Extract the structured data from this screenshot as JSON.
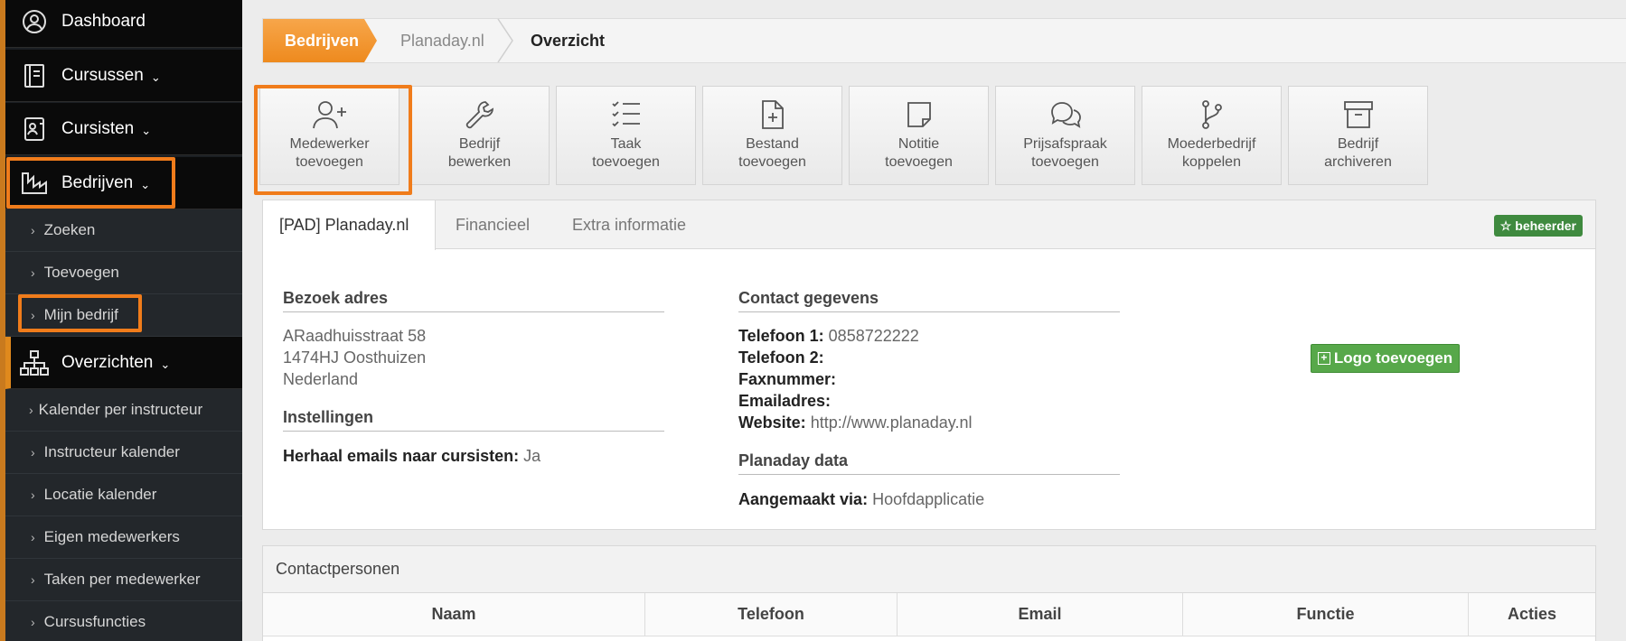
{
  "sidebar": {
    "main": [
      {
        "label": "Dashboard",
        "icon": "user-circle-icon"
      },
      {
        "label": "Cursussen",
        "icon": "book-icon"
      },
      {
        "label": "Cursisten",
        "icon": "id-card-icon"
      },
      {
        "label": "Bedrijven",
        "icon": "factory-icon"
      },
      {
        "label": "Overzichten",
        "icon": "sitemap-icon"
      }
    ],
    "bedrijven_sub": [
      "Zoeken",
      "Toevoegen",
      "Mijn bedrijf"
    ],
    "overzichten_sub": [
      "Kalender per instructeur",
      "Instructeur kalender",
      "Locatie kalender",
      "Eigen medewerkers",
      "Taken per medewerker",
      "Cursusfuncties"
    ]
  },
  "breadcrumb": [
    "Bedrijven",
    "Planaday.nl",
    "Overzicht"
  ],
  "toolbar": [
    {
      "line1": "Medewerker",
      "line2": "toevoegen",
      "icon": "user-plus-icon"
    },
    {
      "line1": "Bedrijf",
      "line2": "bewerken",
      "icon": "wrench-icon"
    },
    {
      "line1": "Taak",
      "line2": "toevoegen",
      "icon": "checklist-icon"
    },
    {
      "line1": "Bestand",
      "line2": "toevoegen",
      "icon": "file-plus-icon"
    },
    {
      "line1": "Notitie",
      "line2": "toevoegen",
      "icon": "note-icon"
    },
    {
      "line1": "Prijsafspraak",
      "line2": "toevoegen",
      "icon": "chat-icon"
    },
    {
      "line1": "Moederbedrijf",
      "line2": "koppelen",
      "icon": "branch-icon"
    },
    {
      "line1": "Bedrijf",
      "line2": "archiveren",
      "icon": "archive-icon"
    }
  ],
  "tabs": [
    "[PAD] Planaday.nl",
    "Financieel",
    "Extra informatie"
  ],
  "badge": "beheerder",
  "bezoek": {
    "title": "Bezoek adres",
    "lines": [
      "ARaadhuisstraat 58",
      "1474HJ Oosthuizen",
      "Nederland"
    ]
  },
  "instellingen": {
    "title": "Instellingen",
    "label": "Herhaal emails naar cursisten:",
    "value": " Ja"
  },
  "contact": {
    "title": "Contact gegevens",
    "rows": [
      {
        "label": "Telefoon 1:",
        "value": " 0858722222"
      },
      {
        "label": "Telefoon 2:",
        "value": ""
      },
      {
        "label": "Faxnummer:",
        "value": ""
      },
      {
        "label": "Emailadres:",
        "value": ""
      },
      {
        "label": "Website:",
        "value": " http://www.planaday.nl"
      }
    ]
  },
  "planaday": {
    "title": "Planaday data",
    "label": "Aangemaakt via:",
    "value": " Hoofdapplicatie"
  },
  "logo_button": "Logo toevoegen",
  "contacts": {
    "title": "Contactpersonen",
    "columns": [
      "Naam",
      "Telefoon",
      "Email",
      "Functie",
      "Acties"
    ]
  },
  "colors": {
    "accent": "#f07c1b",
    "green": "#57a84a",
    "sidebar": "#0a0a0a"
  }
}
